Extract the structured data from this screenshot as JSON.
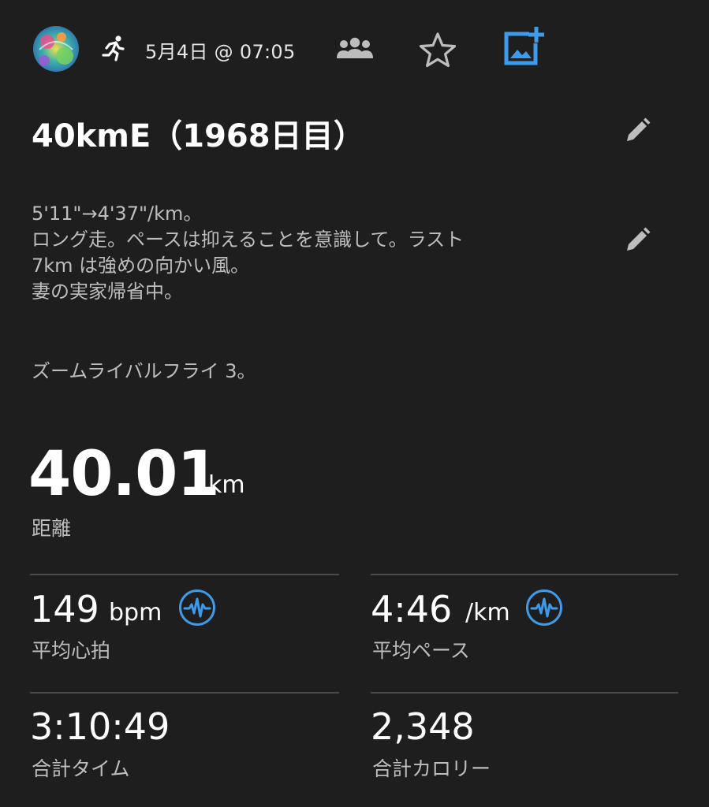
{
  "header": {
    "activity_icon": "running-person-icon",
    "date": "5月4日 @ 07:05",
    "icons": [
      "group-icon",
      "star-icon",
      "add-photo-icon"
    ],
    "accent_color": "#3d9be9"
  },
  "activity": {
    "title": "40kmE（1968日目）",
    "description_lines": [
      "5'11\"→4'37\"/km。",
      "ロング走。ペースは抑えることを意識して。ラスト",
      "7km は強めの向かい風。",
      "妻の実家帰省中。",
      "ズームライバルフライ 3。"
    ]
  },
  "distance": {
    "value": "40.01",
    "unit": "km",
    "label": "距離"
  },
  "stats": {
    "heart_rate": {
      "value": "149",
      "unit": "bpm",
      "label": "平均心拍"
    },
    "pace": {
      "value": "4:46",
      "unit": "/km",
      "label": "平均ペース"
    },
    "time": {
      "value": "3:10:49",
      "label": "合計タイム"
    },
    "calories": {
      "value": "2,348",
      "label": "合計カロリー"
    }
  }
}
